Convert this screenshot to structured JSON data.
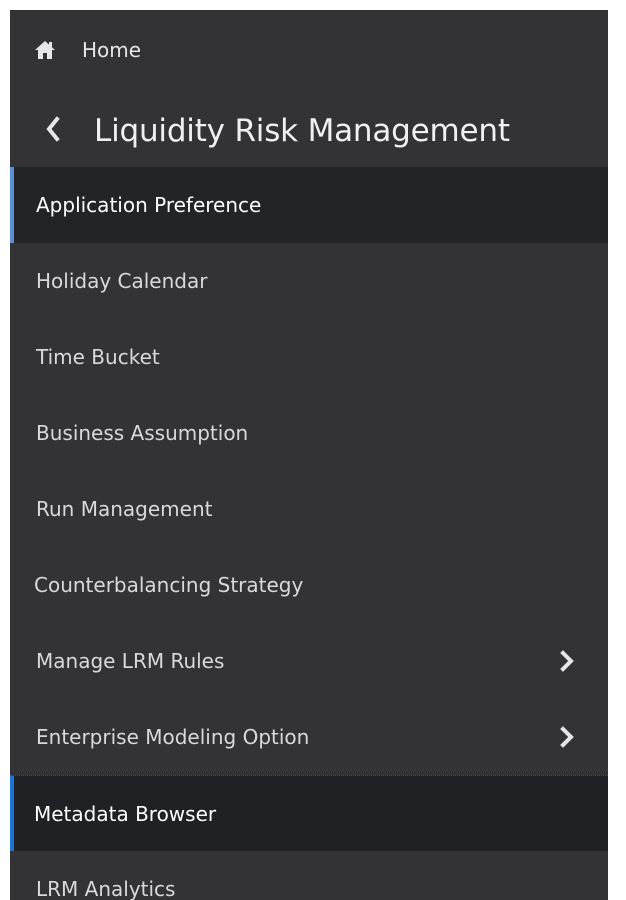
{
  "nav": {
    "home_label": "Home",
    "module_title": "Liquidity Risk Management"
  },
  "menu": {
    "items": [
      {
        "label": "Application Preference",
        "state": "active"
      },
      {
        "label": "Holiday Calendar"
      },
      {
        "label": "Time Bucket"
      },
      {
        "label": "Business Assumption"
      },
      {
        "label": "Run Management"
      },
      {
        "label": "Counterbalancing Strategy"
      },
      {
        "label": "Manage LRM Rules",
        "has_submenu": true,
        "icon": "chevron-right-icon"
      },
      {
        "label": "Enterprise Modeling Option",
        "has_submenu": true,
        "icon": "chevron-right-icon"
      },
      {
        "label": "Metadata Browser",
        "state": "current"
      },
      {
        "label": "LRM Analytics"
      }
    ]
  },
  "colors": {
    "panel_bg": "#333336",
    "active_bg": "#222426",
    "active_accent": "#5b8fd6",
    "current_accent": "#1e73d6",
    "text": "#d9d9d9"
  }
}
